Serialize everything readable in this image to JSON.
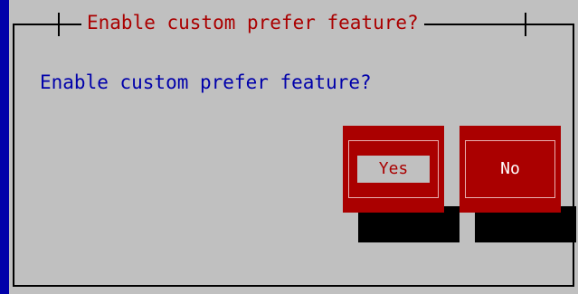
{
  "dialog": {
    "title": "Enable custom prefer feature?",
    "message": "Enable custom prefer feature?"
  },
  "buttons": {
    "yes_label": "Yes",
    "no_label": "No",
    "focused": "yes"
  },
  "colors": {
    "screen_background": "#0000aa",
    "dialog_background": "#c0c0c0",
    "title_text": "#aa0000",
    "message_text": "#0000aa",
    "button_background": "#aa0000",
    "button_text": "#ffffff",
    "focused_label_background": "#c0c0c0"
  }
}
